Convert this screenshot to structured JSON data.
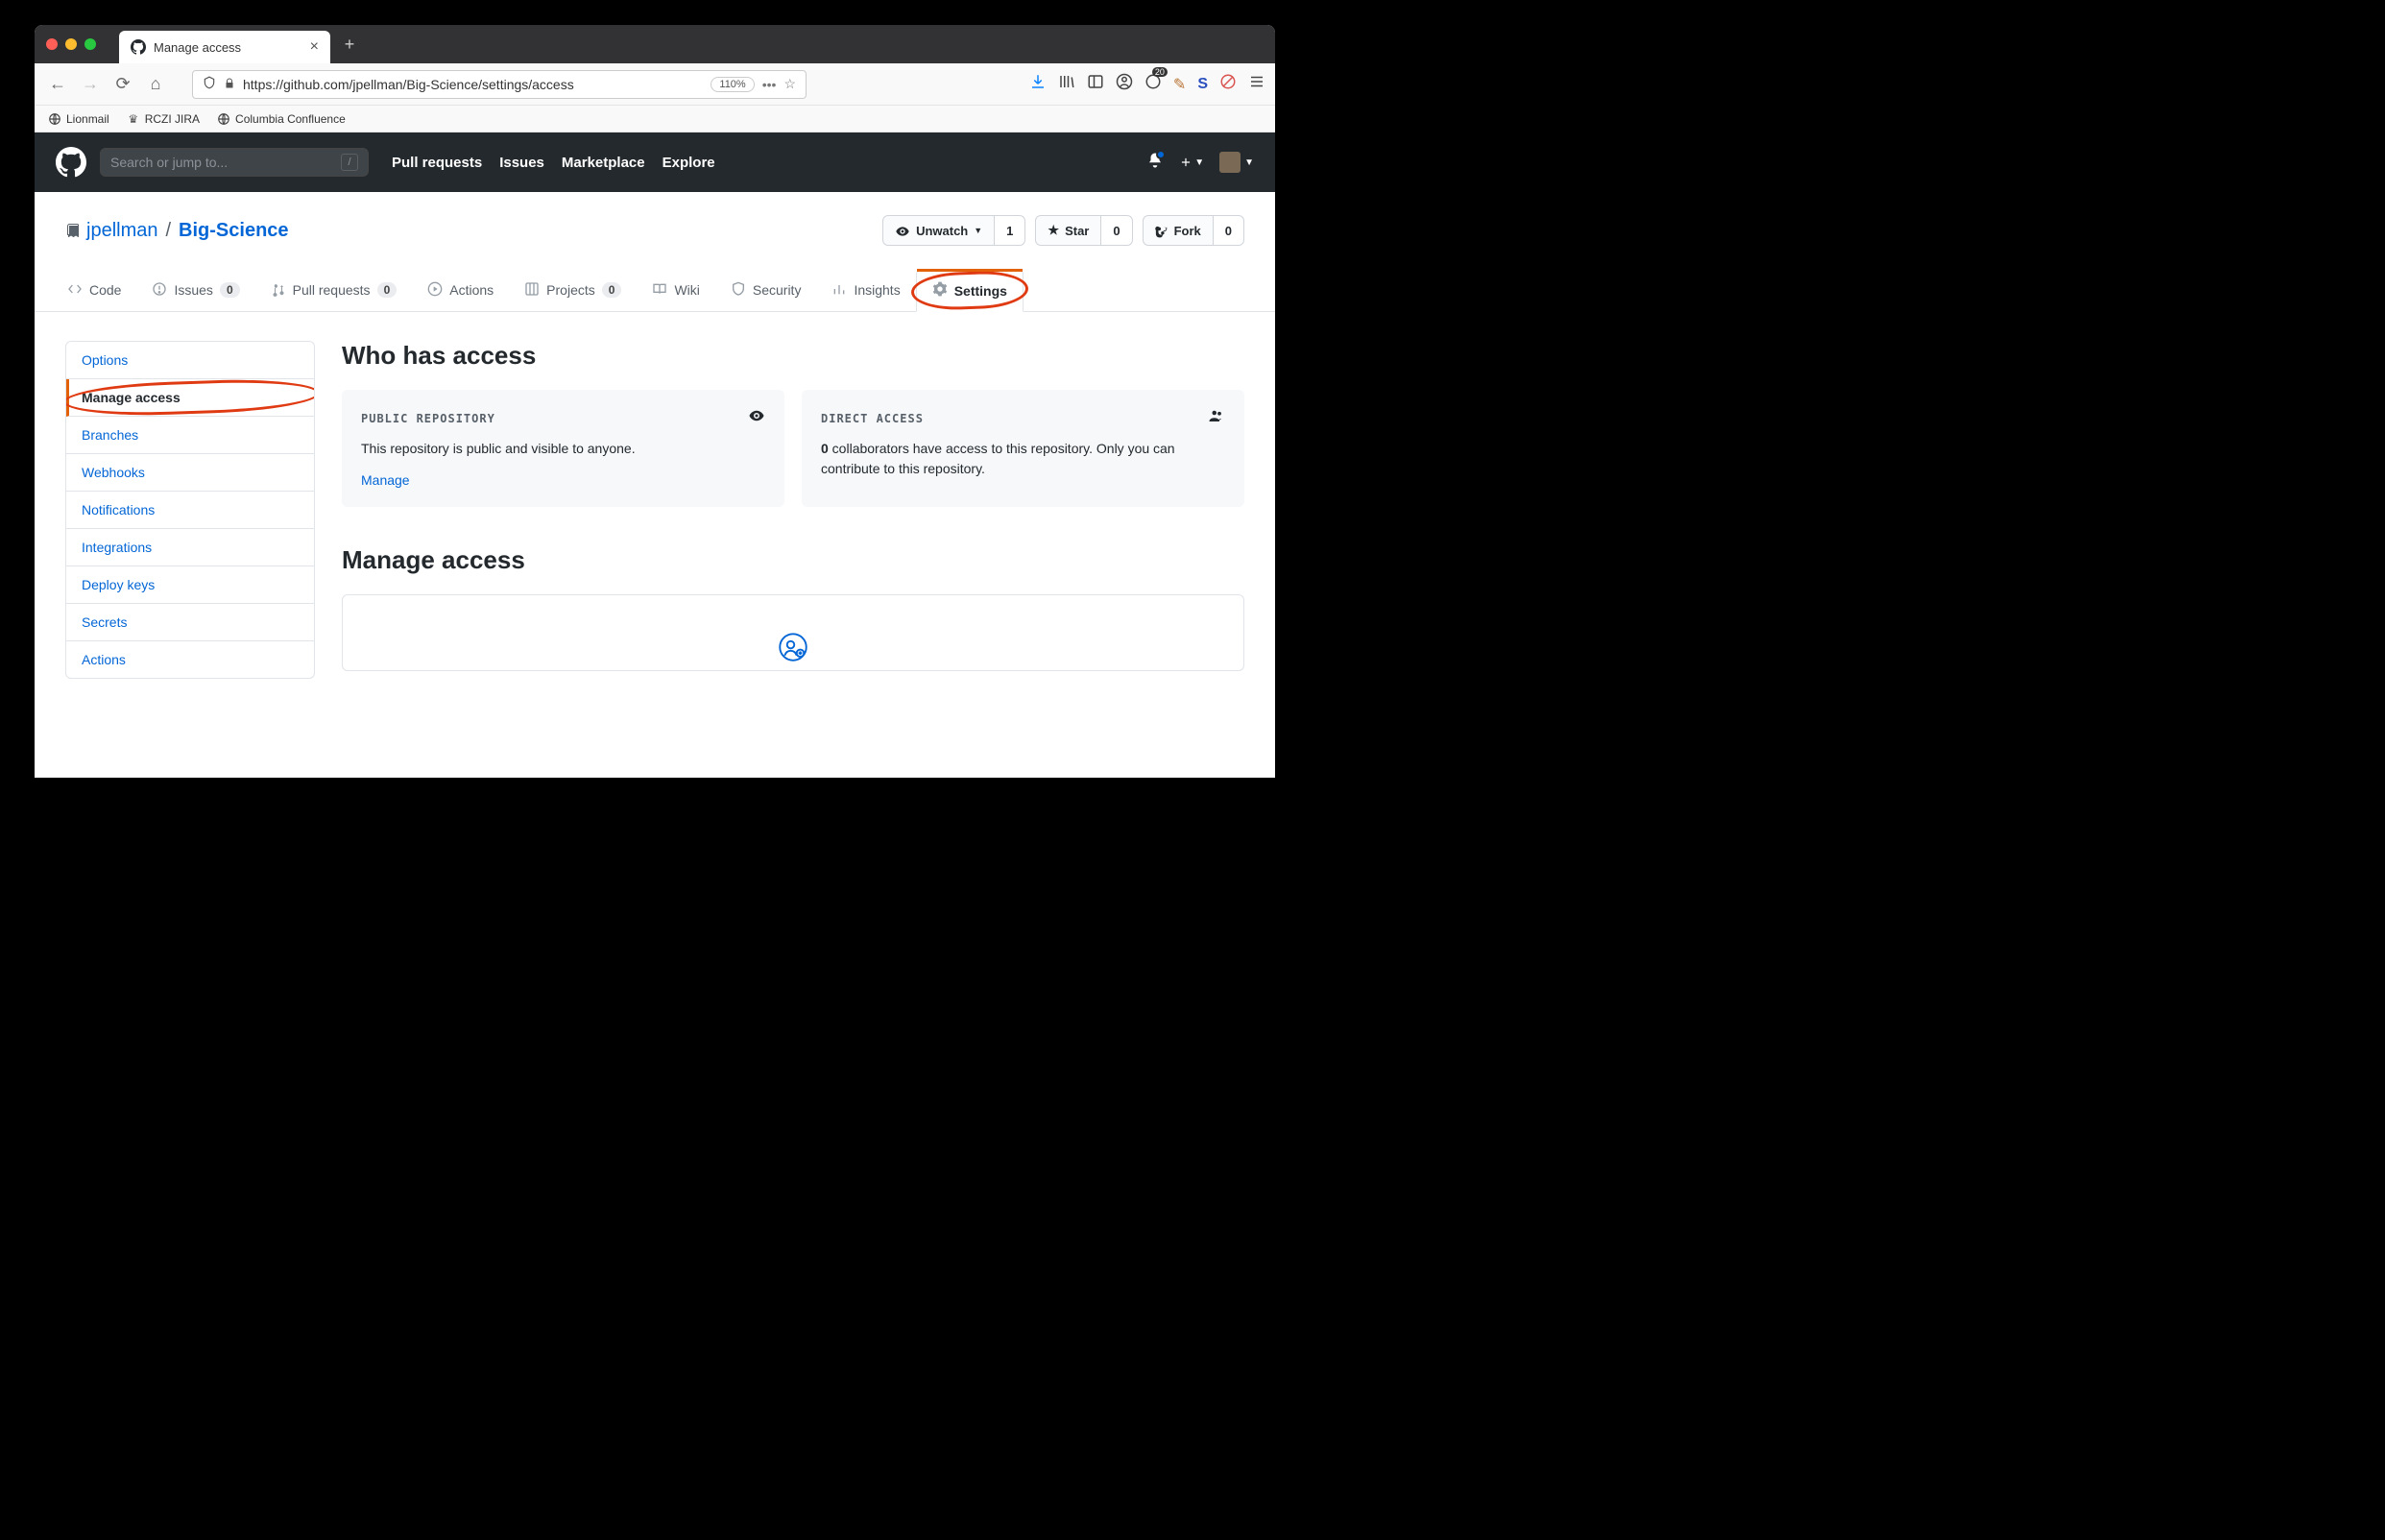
{
  "browser": {
    "tab_title": "Manage access",
    "url": "https://github.com/jpellman/Big-Science/settings/access",
    "zoom": "110%",
    "bookmarks": [
      "Lionmail",
      "RCZI JIRA",
      "Columbia Confluence"
    ],
    "ext_badge": "20"
  },
  "github": {
    "search_placeholder": "Search or jump to...",
    "nav": [
      "Pull requests",
      "Issues",
      "Marketplace",
      "Explore"
    ],
    "owner": "jpellman",
    "repo": "Big-Science",
    "actions": {
      "unwatch": {
        "label": "Unwatch",
        "count": "1"
      },
      "star": {
        "label": "Star",
        "count": "0"
      },
      "fork": {
        "label": "Fork",
        "count": "0"
      }
    },
    "tabs": [
      {
        "label": "Code"
      },
      {
        "label": "Issues",
        "count": "0"
      },
      {
        "label": "Pull requests",
        "count": "0"
      },
      {
        "label": "Actions"
      },
      {
        "label": "Projects",
        "count": "0"
      },
      {
        "label": "Wiki"
      },
      {
        "label": "Security"
      },
      {
        "label": "Insights"
      },
      {
        "label": "Settings"
      }
    ],
    "sidebar": [
      "Options",
      "Manage access",
      "Branches",
      "Webhooks",
      "Notifications",
      "Integrations",
      "Deploy keys",
      "Secrets",
      "Actions"
    ],
    "heading1": "Who has access",
    "card1": {
      "title": "PUBLIC REPOSITORY",
      "body": "This repository is public and visible to anyone.",
      "link": "Manage"
    },
    "card2": {
      "title": "DIRECT ACCESS",
      "count": "0",
      "body": " collaborators have access to this repository. Only you can contribute to this repository."
    },
    "heading2": "Manage access"
  }
}
